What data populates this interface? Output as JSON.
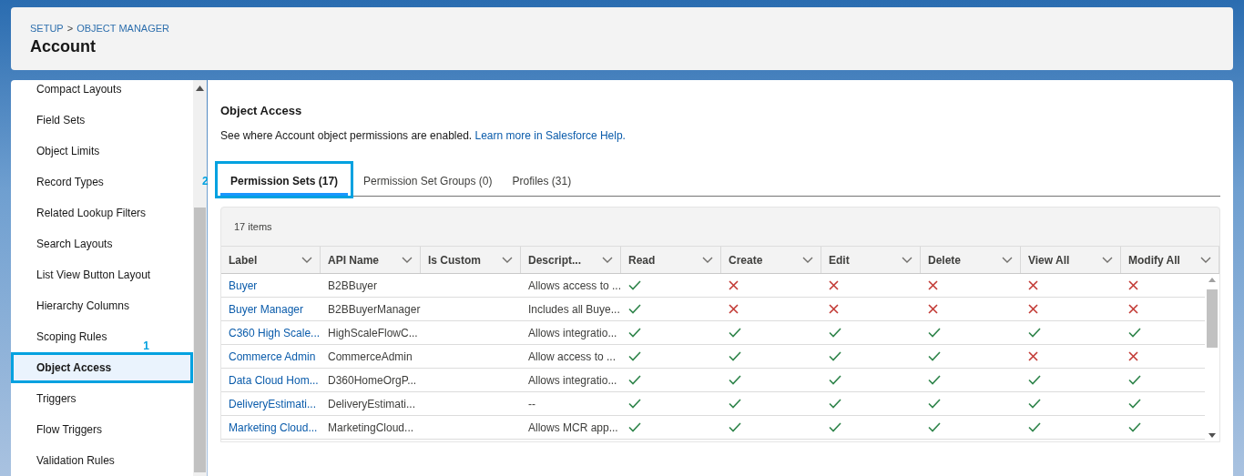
{
  "header": {
    "breadcrumb": [
      {
        "label": "SETUP"
      },
      {
        "label": "OBJECT MANAGER"
      }
    ],
    "separator": ">",
    "title": "Account"
  },
  "sidebar": {
    "items": [
      {
        "label": "Compact Layouts",
        "selected": false
      },
      {
        "label": "Field Sets",
        "selected": false
      },
      {
        "label": "Object Limits",
        "selected": false
      },
      {
        "label": "Record Types",
        "selected": false
      },
      {
        "label": "Related Lookup Filters",
        "selected": false
      },
      {
        "label": "Search Layouts",
        "selected": false
      },
      {
        "label": "List View Button Layout",
        "selected": false
      },
      {
        "label": "Hierarchy Columns",
        "selected": false
      },
      {
        "label": "Scoping Rules",
        "selected": false
      },
      {
        "label": "Object Access",
        "selected": true,
        "callout": "1"
      },
      {
        "label": "Triggers",
        "selected": false
      },
      {
        "label": "Flow Triggers",
        "selected": false
      },
      {
        "label": "Validation Rules",
        "selected": false
      }
    ]
  },
  "main": {
    "title": "Object Access",
    "description": "See where Account object permissions are enabled.",
    "help_link": "Learn more in Salesforce Help.",
    "tabs": [
      {
        "label": "Permission Sets (17)",
        "selected": true,
        "callout": "2"
      },
      {
        "label": "Permission Set Groups (0)",
        "selected": false
      },
      {
        "label": "Profiles (31)",
        "selected": false
      }
    ],
    "table": {
      "item_count": "17 items",
      "columns": [
        {
          "label": "Label",
          "kind": "label"
        },
        {
          "label": "API Name",
          "kind": "api_name"
        },
        {
          "label": "Is Custom",
          "kind": "is_custom"
        },
        {
          "label": "Descript...",
          "kind": "description"
        },
        {
          "label": "Read",
          "kind": "permission"
        },
        {
          "label": "Create",
          "kind": "permission"
        },
        {
          "label": "Edit",
          "kind": "permission"
        },
        {
          "label": "Delete",
          "kind": "permission"
        },
        {
          "label": "View All",
          "kind": "permission"
        },
        {
          "label": "Modify All",
          "kind": "permission"
        }
      ],
      "rows": [
        {
          "label": "Buyer",
          "api_name": "B2BBuyer",
          "description": "Allows access to ...",
          "permissions": [
            true,
            false,
            false,
            false,
            false,
            false
          ]
        },
        {
          "label": "Buyer Manager",
          "api_name": "B2BBuyerManager",
          "description": "Includes all Buye...",
          "permissions": [
            true,
            false,
            false,
            false,
            false,
            false
          ]
        },
        {
          "label": "C360 High Scale...",
          "api_name": "HighScaleFlowC...",
          "description": "Allows integratio...",
          "permissions": [
            true,
            true,
            true,
            true,
            true,
            true
          ]
        },
        {
          "label": "Commerce Admin",
          "api_name": "CommerceAdmin",
          "description": "Allow access to ...",
          "permissions": [
            true,
            true,
            true,
            true,
            false,
            false
          ]
        },
        {
          "label": "Data Cloud Hom...",
          "api_name": "D360HomeOrgP...",
          "description": "Allows integratio...",
          "permissions": [
            true,
            true,
            true,
            true,
            true,
            true
          ]
        },
        {
          "label": "DeliveryEstimati...",
          "api_name": "DeliveryEstimati...",
          "description": "--",
          "permissions": [
            true,
            true,
            true,
            true,
            true,
            true
          ]
        },
        {
          "label": "Marketing Cloud...",
          "api_name": "MarketingCloud...",
          "description": "Allows MCR app...",
          "permissions": [
            true,
            true,
            true,
            true,
            true,
            true
          ]
        }
      ]
    }
  }
}
